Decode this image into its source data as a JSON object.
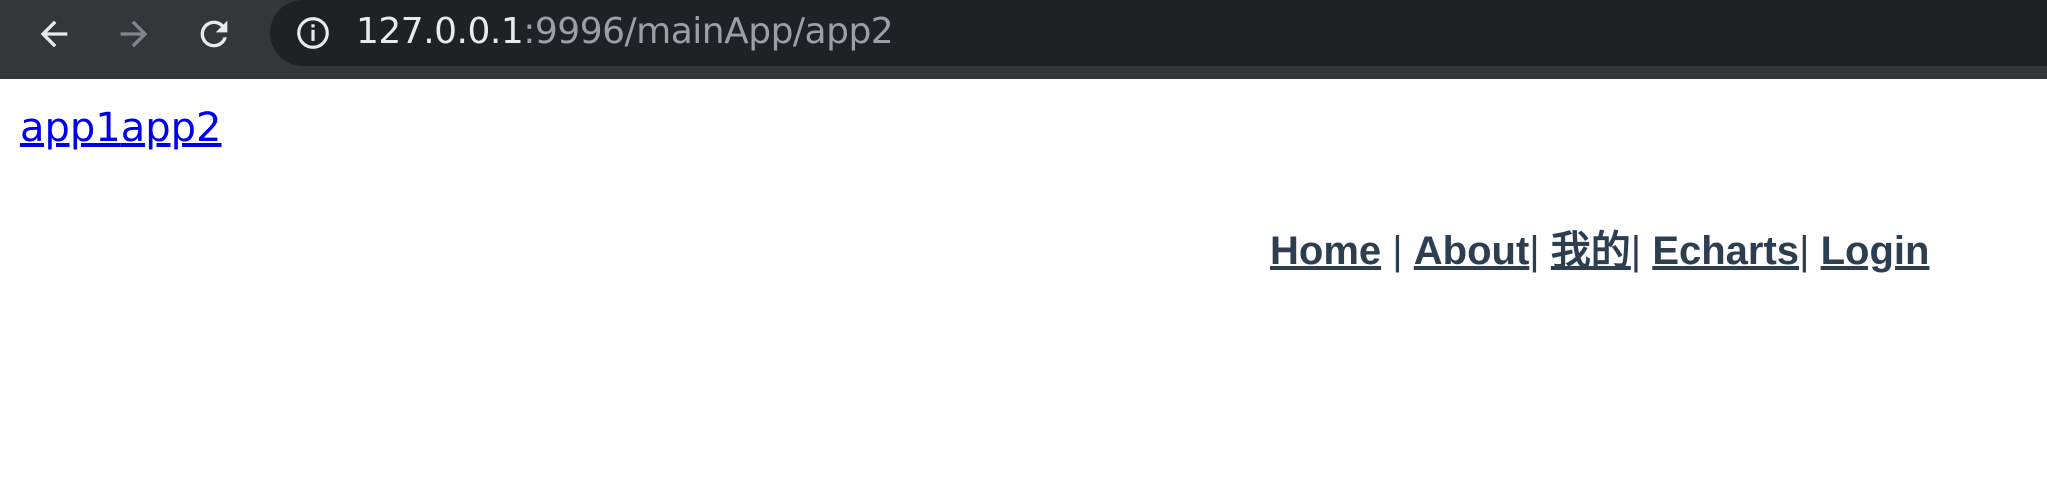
{
  "browser": {
    "url_host": "127.0.0.1",
    "url_rest": ":9996/mainApp/app2",
    "back_icon": "arrow-left-icon",
    "forward_icon": "arrow-right-icon",
    "reload_icon": "reload-icon",
    "info_icon": "info-icon"
  },
  "page": {
    "links": [
      "app1",
      "app2"
    ],
    "nav": {
      "items": [
        "Home",
        "About",
        "我的",
        "Echarts",
        "Login"
      ],
      "separators": [
        " | ",
        "| ",
        "| ",
        "| "
      ]
    }
  },
  "colors": {
    "toolbar_bg": "#35363a",
    "omnibox_bg": "#202124",
    "link": "#0000ee",
    "nav_text": "#2c3e50"
  }
}
